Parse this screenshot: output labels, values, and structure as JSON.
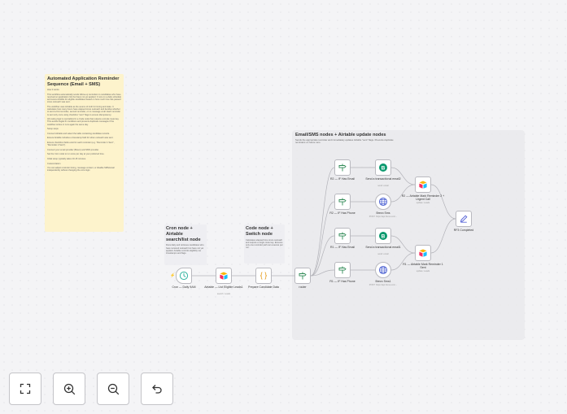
{
  "sticky": {
    "title": "Automated Application Reminder Sequence (Email + SMS)",
    "lines": [
      "How it works",
      "This workflow automatically sends follow-up reminders to candidates who have received an application link but have not yet applied. It runs on a daily schedule and scans Airtable for eligible candidates based on how much time has passed since outreach was sent.",
      "The workflow uses Airtable as the source of truth for timing and state. It calculates how many hours have elapsed since outreach and decides whether to send a first reminder, second reminder, or no message at all. Each reminder is sent only once using checkbox \"sent\" flags to ensure idempotency.",
      "All routing logic is centralized in a Code node that outputs a simple route key. This avoids fragile IF conditions and prevents duplicate messages if the workflow retries or runs again the same day.",
      "Setup steps",
      "Connect Airtable and select the table containing candidate records.",
      "Ensure Airtable includes a timestamp field for when outreach was sent.",
      "Ensure checkbox fields exist for each reminder (e.g. \"Reminder 1 Sent\", \"Reminder 2 Sent\").",
      "Connect your email provider (Brevo) and SMS provider.",
      "Set the Cron node to run once per day at your preferred time.",
      "Initial setup typically takes 10-15 minutes.",
      "Customization",
      "You can adjust reminder timing, message content, or disable SMS/email independently without changing the core logic."
    ]
  },
  "notes": {
    "cron": {
      "title": "Cron node + Airtable search/list node",
      "body": "Runs daily and retrieves candidates who have received outreach but have not yet applied. Airtable controls eligibility via timestamps and flags."
    },
    "code": {
      "title": "Code node + Switch node",
      "body": "Calculates elapsed time since outreach and outputs a single route key. Ensures only one reminder path can execute per run."
    }
  },
  "group": {
    "title": "Email/SMS nodes + Airtable update nodes",
    "description": "Sends the appropriate reminder and immediately updates Airtable \"sent\" flags. Prevents duplicate reminders on future runs."
  },
  "nodes": {
    "cron": {
      "label": "Cron — Daily 9AM",
      "sub": "",
      "icon": "clock-icon"
    },
    "airtable_list": {
      "label": "Airtable — List Eligible Leads1",
      "sub": "search: Leads",
      "icon": "airtable-icon"
    },
    "prepare": {
      "label": "Prepare Candidate Data",
      "sub": "",
      "icon": "code-braces-icon"
    },
    "router": {
      "label": "router",
      "sub": "",
      "icon": "signpost-icon"
    },
    "if_email_1": {
      "label": "R2 — IF Has Email",
      "sub": "",
      "icon": "signpost-icon"
    },
    "if_phone_1": {
      "label": "R2 — IF Has Phone",
      "sub": "",
      "icon": "signpost-icon"
    },
    "if_email_2": {
      "label": "R1 — IF Has Email",
      "sub": "",
      "icon": "signpost-icon"
    },
    "if_phone_2": {
      "label": "R1 — IF Has Phone",
      "sub": "",
      "icon": "signpost-icon"
    },
    "email_1": {
      "label": "Send a transactional email2",
      "sub": "send: email",
      "icon": "brevo-icon"
    },
    "sms_1": {
      "label": "Brevo Sms",
      "sub": "POST: https://api.brevo.com...",
      "icon": "globe-icon"
    },
    "email_2": {
      "label": "Send a transactional email1",
      "sub": "send: email",
      "icon": "brevo-icon"
    },
    "sms_2": {
      "label": "Brevo Sms1",
      "sub": "POST: https://api.brevo.com...",
      "icon": "globe-icon"
    },
    "mark_2": {
      "label": "R2 — Airtable Mark Reminder 2 + Urgent Call",
      "sub": "update: Leads",
      "icon": "airtable-icon"
    },
    "mark_1": {
      "label": "R1 — Airtable Mark Reminder 1 Sent",
      "sub": "update: Leads",
      "icon": "airtable-icon"
    },
    "done": {
      "label": "RF3 Completed",
      "sub": "",
      "icon": "pencil-icon"
    }
  },
  "controls": {
    "fit_view": {
      "icon": "fit-view-icon"
    },
    "zoom_in": {
      "icon": "zoom-in-icon"
    },
    "zoom_out": {
      "icon": "zoom-out-icon"
    },
    "undo": {
      "icon": "undo-icon"
    }
  },
  "colors": {
    "trigger_accent": "#ff6d5a",
    "clock": "#35b5a2",
    "code": "#e8a93a",
    "router": "#2f8a55",
    "brevo": "#0b996e",
    "globe": "#5468d4",
    "pencil": "#4d5bd4",
    "sticky_bg": "#fdf3cc"
  }
}
